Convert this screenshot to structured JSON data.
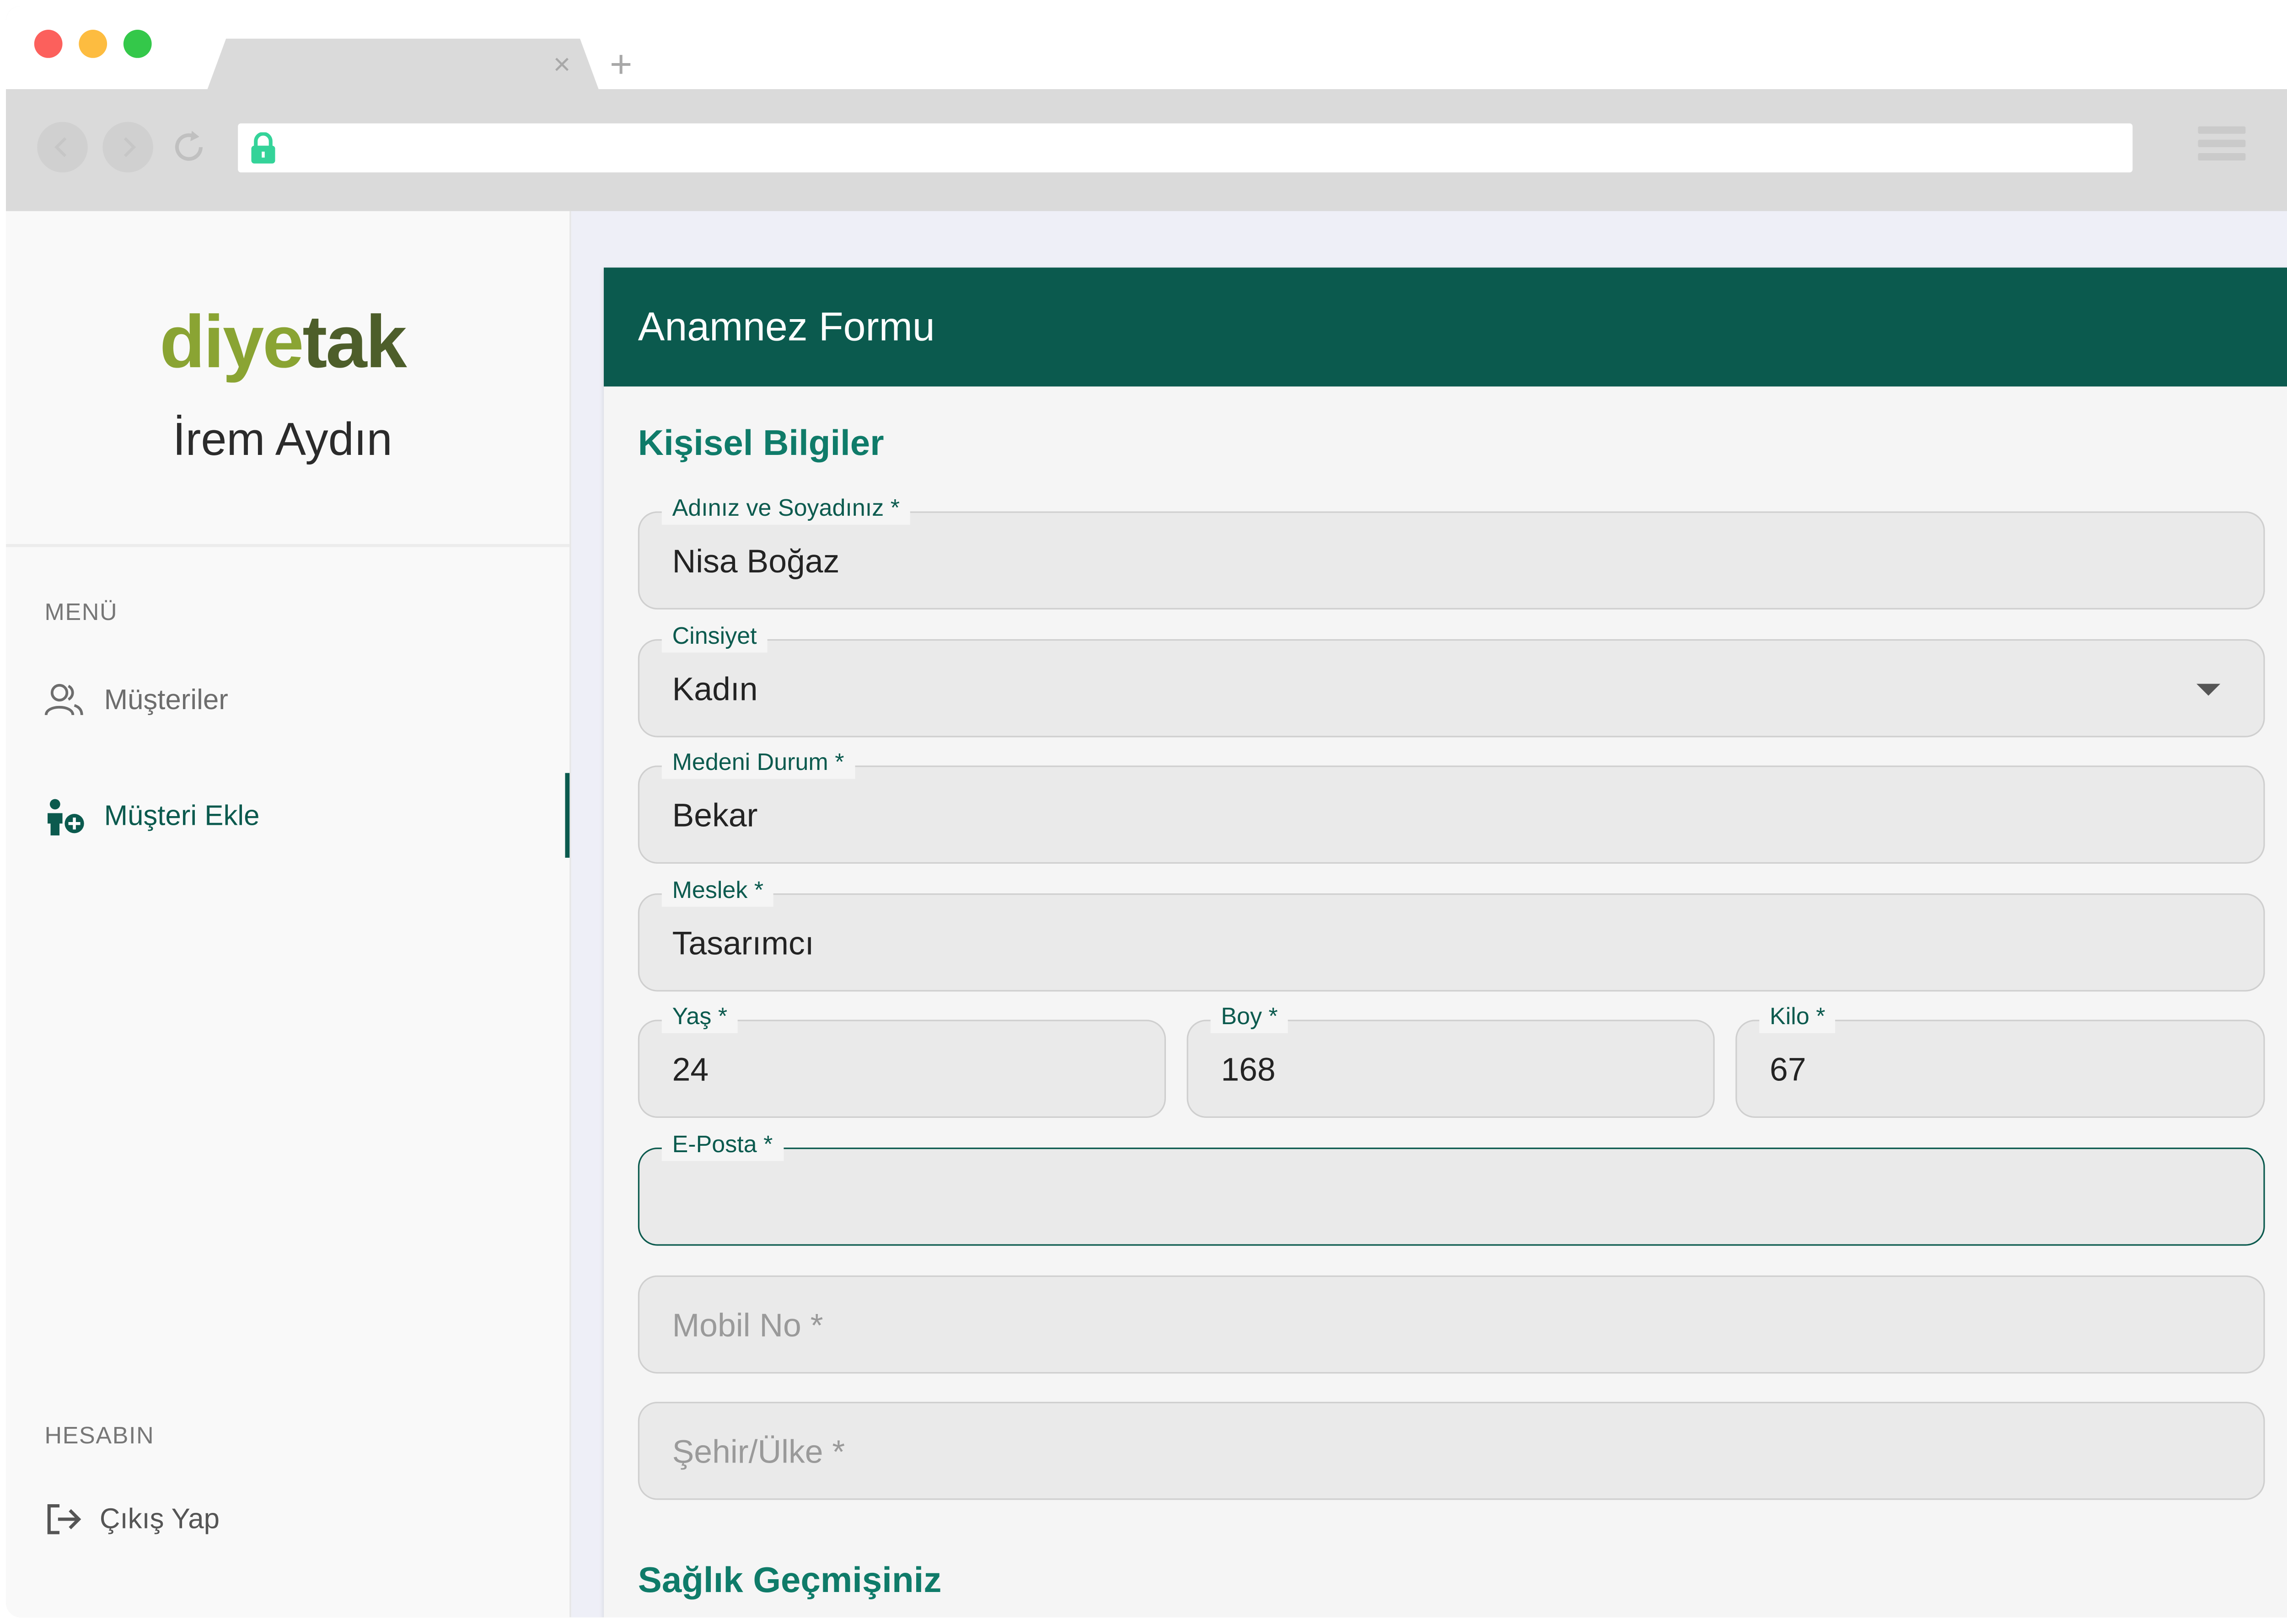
{
  "browser": {
    "tab_close": "×",
    "tab_new": "+",
    "colors": {
      "close": "#fc605c",
      "minimize": "#fdbc40",
      "maximize": "#34c84a",
      "lock": "#34d399"
    }
  },
  "sidebar": {
    "logo_part1": "diye",
    "logo_part2": "tak",
    "user_name": "İrem Aydın",
    "menu_label": "MENÜ",
    "items": [
      {
        "label": "Müşteriler",
        "icon": "users-icon",
        "active": false
      },
      {
        "label": "Müşteri Ekle",
        "icon": "user-add-icon",
        "active": true
      }
    ],
    "account_label": "HESABIN",
    "logout": {
      "label": "Çıkış Yap",
      "icon": "logout-icon"
    }
  },
  "form": {
    "title": "Anamnez Formu",
    "section_personal": "Kişisel Bilgiler",
    "section_health": "Sağlık Geçmişiniz",
    "fields": {
      "name": {
        "label": "Adınız ve Soyadınız *",
        "value": "Nisa Boğaz"
      },
      "gender": {
        "label": "Cinsiyet",
        "value": "Kadın"
      },
      "marital": {
        "label": "Medeni Durum *",
        "value": "Bekar"
      },
      "job": {
        "label": "Meslek *",
        "value": "Tasarımcı"
      },
      "age": {
        "label": "Yaş *",
        "value": "24"
      },
      "height": {
        "label": "Boy *",
        "value": "168"
      },
      "weight": {
        "label": "Kilo *",
        "value": "67"
      },
      "email": {
        "label": "E-Posta *",
        "value": ""
      },
      "mobile": {
        "placeholder": "Mobil No *"
      },
      "city": {
        "placeholder": "Şehir/Ülke *"
      }
    },
    "accent_color": "#0b5a4e"
  }
}
